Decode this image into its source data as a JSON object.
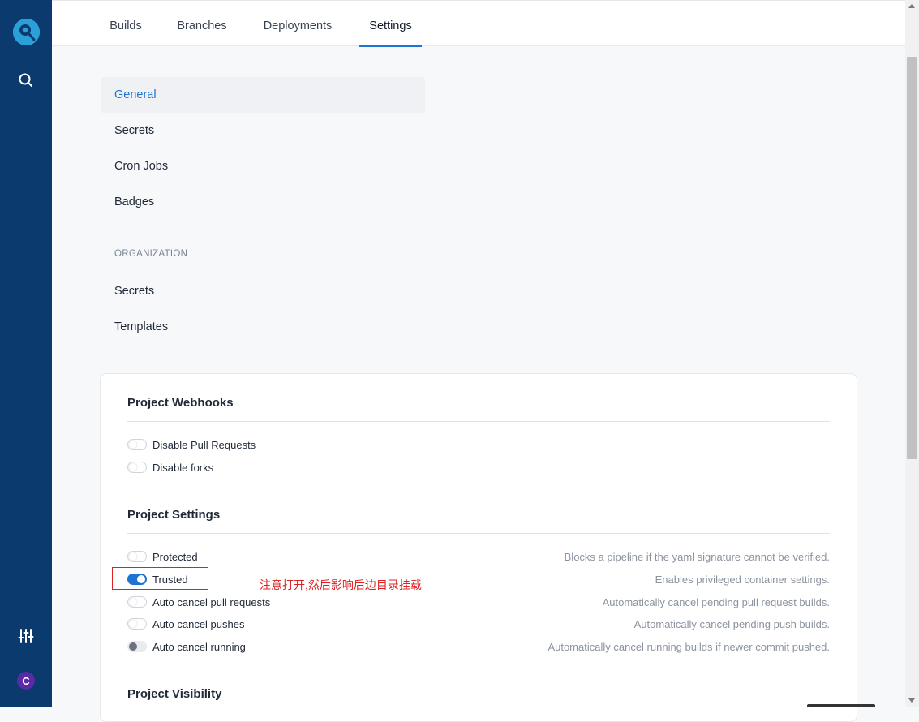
{
  "nav": {
    "logo": "drone-logo-icon",
    "search_icon": "search-icon",
    "settings_icon": "sliders-icon",
    "avatar_initial": "C"
  },
  "tabs": [
    {
      "label": "Builds",
      "active": false
    },
    {
      "label": "Branches",
      "active": false
    },
    {
      "label": "Deployments",
      "active": false
    },
    {
      "label": "Settings",
      "active": true
    }
  ],
  "menu": {
    "repo_items": [
      "General",
      "Secrets",
      "Cron Jobs",
      "Badges"
    ],
    "org_heading": "ORGANIZATION",
    "org_items": [
      "Secrets",
      "Templates"
    ],
    "active": "General"
  },
  "webhooks": {
    "title": "Project Webhooks",
    "options": [
      {
        "label": "Disable Pull Requests",
        "on": false
      },
      {
        "label": "Disable forks",
        "on": false
      }
    ]
  },
  "settings": {
    "title": "Project Settings",
    "options": [
      {
        "label": "Protected",
        "description": "Blocks a pipeline if the yaml signature cannot be verified.",
        "state": "off"
      },
      {
        "label": "Trusted",
        "description": "Enables privileged container settings.",
        "state": "on"
      },
      {
        "label": "Auto cancel pull requests",
        "description": "Automatically cancel pending pull request builds.",
        "state": "off"
      },
      {
        "label": "Auto cancel pushes",
        "description": "Automatically cancel pending push builds.",
        "state": "off"
      },
      {
        "label": "Auto cancel running",
        "description": "Automatically cancel running builds if newer commit pushed.",
        "state": "disabled"
      }
    ]
  },
  "visibility": {
    "title": "Project Visibility"
  },
  "annotation": {
    "text": "注意打开,然后影响后边目录挂载",
    "color": "#e02020"
  },
  "colors": {
    "sidebar": "#0b3a6e",
    "accent": "#1d74d1",
    "annotation": "#e02020"
  }
}
